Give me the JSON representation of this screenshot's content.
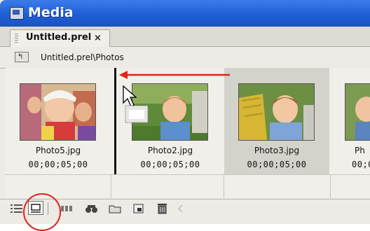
{
  "window": {
    "title": "Media"
  },
  "tab": {
    "label": "Untitled.prel",
    "close_glyph": "×"
  },
  "path": {
    "up_glyph": "↰",
    "text": "Untitled.prel\\Photos"
  },
  "thumbnails": [
    {
      "name": "Photo5.jpg",
      "duration": "00;00;05;00"
    },
    {
      "name": "Photo2.jpg",
      "duration": "00;00;05;00"
    },
    {
      "name": "Photo3.jpg",
      "duration": "00;00;05;00"
    },
    {
      "name": "Ph",
      "duration": "00;0"
    }
  ],
  "toolbar": {
    "icons": [
      "list-view-icon",
      "icon-view-icon",
      "storyboard-icon",
      "find-icon",
      "new-bin-icon",
      "new-item-icon",
      "delete-icon",
      "collapse-icon"
    ]
  },
  "colors": {
    "annotation": "#e2231a",
    "titlebar": "#1f5fd6",
    "selection": "#d4d3cb"
  }
}
